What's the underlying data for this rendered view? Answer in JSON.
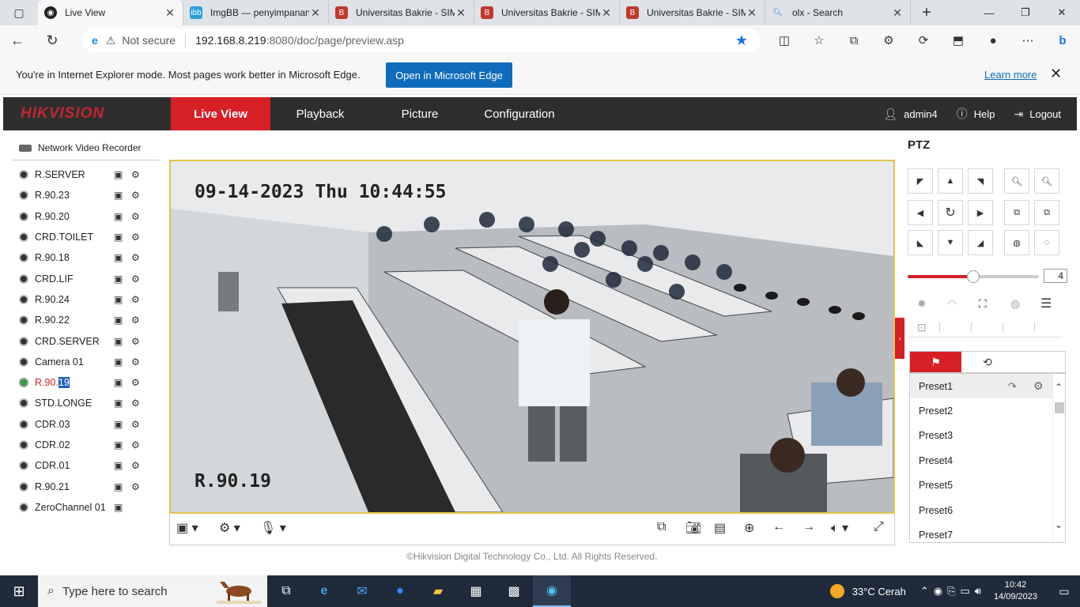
{
  "browser": {
    "tabs": [
      {
        "title": "Live View",
        "favicon": "hikvision-favicon",
        "active": true
      },
      {
        "title": "ImgBB — penyimpanan",
        "favicon": "imgbb-favicon"
      },
      {
        "title": "Universitas Bakrie - SIM",
        "favicon": "bakrie-favicon"
      },
      {
        "title": "Universitas Bakrie - SIM",
        "favicon": "bakrie-favicon"
      },
      {
        "title": "Universitas Bakrie - SIM",
        "favicon": "bakrie-favicon"
      },
      {
        "title": "olx - Search",
        "favicon": "search-favicon"
      }
    ],
    "new_tab": "+",
    "address": {
      "security": "Not secure",
      "host": "192.168.8.219",
      "path": ":8080/doc/page/preview.asp"
    },
    "ie_bar": {
      "message": "You're in Internet Explorer mode. Most pages work better in Microsoft Edge.",
      "open_button": "Open in Microsoft Edge",
      "learn_more": "Learn more"
    }
  },
  "hikvision": {
    "logo": "HIKVISION",
    "nav": [
      "Live View",
      "Playback",
      "Picture",
      "Configuration"
    ],
    "active_nav": "Live View",
    "user": "admin4",
    "help": "Help",
    "logout": "Logout",
    "device_label": "Network Video Recorder",
    "cameras": [
      {
        "name": "R.SERVER"
      },
      {
        "name": "R.90.23"
      },
      {
        "name": "R.90.20"
      },
      {
        "name": "CRD.TOILET"
      },
      {
        "name": "R.90.18"
      },
      {
        "name": "CRD.LIF"
      },
      {
        "name": "R.90.24"
      },
      {
        "name": "R.90.22"
      },
      {
        "name": "CRD.SERVER"
      },
      {
        "name": "Camera 01"
      },
      {
        "name_a": "R.90.",
        "name_b": "19",
        "live": true
      },
      {
        "name": "STD.LONGE"
      },
      {
        "name": "CDR.03"
      },
      {
        "name": "CDR.02"
      },
      {
        "name": "CDR.01"
      },
      {
        "name": "R.90.21"
      },
      {
        "name": "ZeroChannel 01",
        "zero": true
      }
    ],
    "video": {
      "osd_time": "09-14-2023 Thu 10:44:55",
      "osd_name": "R.90.19"
    },
    "footer": "©Hikvision Digital Technology Co., Ltd. All Rights Reserved.",
    "ptz": {
      "title": "PTZ",
      "speed": "4",
      "speed_fraction": 0.5,
      "presets": [
        "Preset1",
        "Preset2",
        "Preset3",
        "Preset4",
        "Preset5",
        "Preset6",
        "Preset7"
      ]
    }
  },
  "taskbar": {
    "search_placeholder": "Type here to search",
    "weather": "33°C  Cerah",
    "time": "10:42",
    "date": "14/09/2023"
  },
  "colors": {
    "accent_red": "#d71f26",
    "header_dark": "#2e2e2e",
    "video_border": "#e3c44b",
    "edge_blue": "#0f6cbd"
  }
}
